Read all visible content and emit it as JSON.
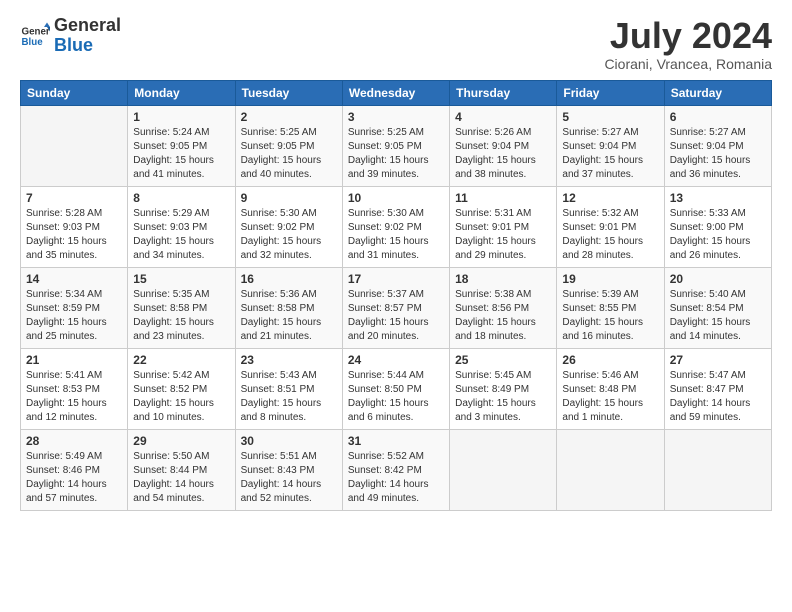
{
  "logo": {
    "line1": "General",
    "line2": "Blue"
  },
  "title": "July 2024",
  "location": "Ciorani, Vrancea, Romania",
  "headers": [
    "Sunday",
    "Monday",
    "Tuesday",
    "Wednesday",
    "Thursday",
    "Friday",
    "Saturday"
  ],
  "weeks": [
    [
      {
        "day": "",
        "content": ""
      },
      {
        "day": "1",
        "content": "Sunrise: 5:24 AM\nSunset: 9:05 PM\nDaylight: 15 hours\nand 41 minutes."
      },
      {
        "day": "2",
        "content": "Sunrise: 5:25 AM\nSunset: 9:05 PM\nDaylight: 15 hours\nand 40 minutes."
      },
      {
        "day": "3",
        "content": "Sunrise: 5:25 AM\nSunset: 9:05 PM\nDaylight: 15 hours\nand 39 minutes."
      },
      {
        "day": "4",
        "content": "Sunrise: 5:26 AM\nSunset: 9:04 PM\nDaylight: 15 hours\nand 38 minutes."
      },
      {
        "day": "5",
        "content": "Sunrise: 5:27 AM\nSunset: 9:04 PM\nDaylight: 15 hours\nand 37 minutes."
      },
      {
        "day": "6",
        "content": "Sunrise: 5:27 AM\nSunset: 9:04 PM\nDaylight: 15 hours\nand 36 minutes."
      }
    ],
    [
      {
        "day": "7",
        "content": "Sunrise: 5:28 AM\nSunset: 9:03 PM\nDaylight: 15 hours\nand 35 minutes."
      },
      {
        "day": "8",
        "content": "Sunrise: 5:29 AM\nSunset: 9:03 PM\nDaylight: 15 hours\nand 34 minutes."
      },
      {
        "day": "9",
        "content": "Sunrise: 5:30 AM\nSunset: 9:02 PM\nDaylight: 15 hours\nand 32 minutes."
      },
      {
        "day": "10",
        "content": "Sunrise: 5:30 AM\nSunset: 9:02 PM\nDaylight: 15 hours\nand 31 minutes."
      },
      {
        "day": "11",
        "content": "Sunrise: 5:31 AM\nSunset: 9:01 PM\nDaylight: 15 hours\nand 29 minutes."
      },
      {
        "day": "12",
        "content": "Sunrise: 5:32 AM\nSunset: 9:01 PM\nDaylight: 15 hours\nand 28 minutes."
      },
      {
        "day": "13",
        "content": "Sunrise: 5:33 AM\nSunset: 9:00 PM\nDaylight: 15 hours\nand 26 minutes."
      }
    ],
    [
      {
        "day": "14",
        "content": "Sunrise: 5:34 AM\nSunset: 8:59 PM\nDaylight: 15 hours\nand 25 minutes."
      },
      {
        "day": "15",
        "content": "Sunrise: 5:35 AM\nSunset: 8:58 PM\nDaylight: 15 hours\nand 23 minutes."
      },
      {
        "day": "16",
        "content": "Sunrise: 5:36 AM\nSunset: 8:58 PM\nDaylight: 15 hours\nand 21 minutes."
      },
      {
        "day": "17",
        "content": "Sunrise: 5:37 AM\nSunset: 8:57 PM\nDaylight: 15 hours\nand 20 minutes."
      },
      {
        "day": "18",
        "content": "Sunrise: 5:38 AM\nSunset: 8:56 PM\nDaylight: 15 hours\nand 18 minutes."
      },
      {
        "day": "19",
        "content": "Sunrise: 5:39 AM\nSunset: 8:55 PM\nDaylight: 15 hours\nand 16 minutes."
      },
      {
        "day": "20",
        "content": "Sunrise: 5:40 AM\nSunset: 8:54 PM\nDaylight: 15 hours\nand 14 minutes."
      }
    ],
    [
      {
        "day": "21",
        "content": "Sunrise: 5:41 AM\nSunset: 8:53 PM\nDaylight: 15 hours\nand 12 minutes."
      },
      {
        "day": "22",
        "content": "Sunrise: 5:42 AM\nSunset: 8:52 PM\nDaylight: 15 hours\nand 10 minutes."
      },
      {
        "day": "23",
        "content": "Sunrise: 5:43 AM\nSunset: 8:51 PM\nDaylight: 15 hours\nand 8 minutes."
      },
      {
        "day": "24",
        "content": "Sunrise: 5:44 AM\nSunset: 8:50 PM\nDaylight: 15 hours\nand 6 minutes."
      },
      {
        "day": "25",
        "content": "Sunrise: 5:45 AM\nSunset: 8:49 PM\nDaylight: 15 hours\nand 3 minutes."
      },
      {
        "day": "26",
        "content": "Sunrise: 5:46 AM\nSunset: 8:48 PM\nDaylight: 15 hours\nand 1 minute."
      },
      {
        "day": "27",
        "content": "Sunrise: 5:47 AM\nSunset: 8:47 PM\nDaylight: 14 hours\nand 59 minutes."
      }
    ],
    [
      {
        "day": "28",
        "content": "Sunrise: 5:49 AM\nSunset: 8:46 PM\nDaylight: 14 hours\nand 57 minutes."
      },
      {
        "day": "29",
        "content": "Sunrise: 5:50 AM\nSunset: 8:44 PM\nDaylight: 14 hours\nand 54 minutes."
      },
      {
        "day": "30",
        "content": "Sunrise: 5:51 AM\nSunset: 8:43 PM\nDaylight: 14 hours\nand 52 minutes."
      },
      {
        "day": "31",
        "content": "Sunrise: 5:52 AM\nSunset: 8:42 PM\nDaylight: 14 hours\nand 49 minutes."
      },
      {
        "day": "",
        "content": ""
      },
      {
        "day": "",
        "content": ""
      },
      {
        "day": "",
        "content": ""
      }
    ]
  ]
}
